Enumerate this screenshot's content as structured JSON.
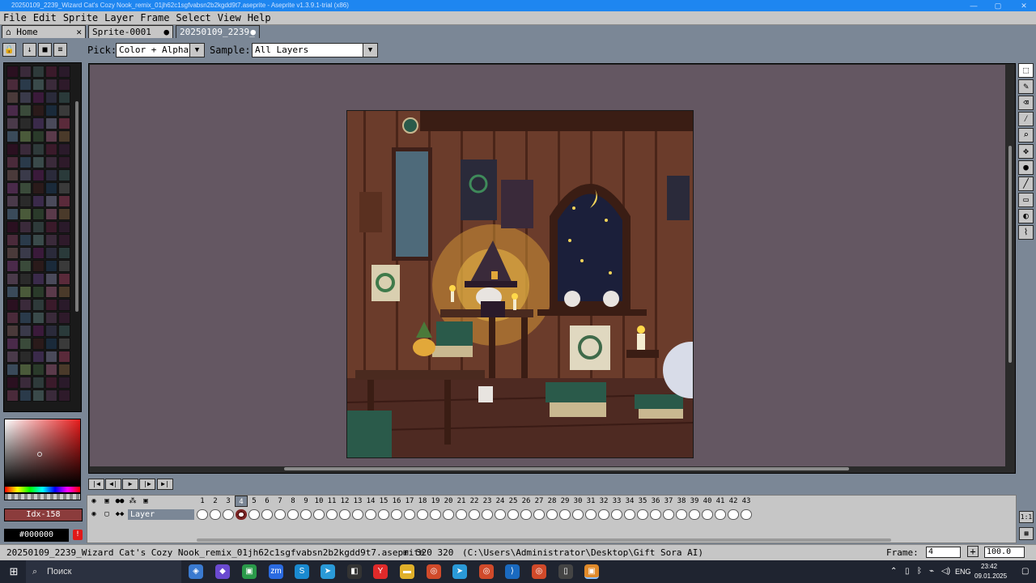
{
  "window": {
    "title": "20250109_2239_Wizard Cat's Cozy Nook_remix_01jh62c1sgfvabsn2b2kgdd9t7.aseprite - Aseprite v1.3.9.1-trial (x86)",
    "min_label": "—",
    "max_label": "▢",
    "close_label": "✕"
  },
  "menu": [
    "File",
    "Edit",
    "Sprite",
    "Layer",
    "Frame",
    "Select",
    "View",
    "Help"
  ],
  "tabs": [
    {
      "label": "Home",
      "close": "✕",
      "icon": "home-icon"
    },
    {
      "label": "Sprite-0001",
      "close": "●"
    },
    {
      "label": "20250109_2239_",
      "close": "●"
    }
  ],
  "tool_options": {
    "pick_label": "Pick:",
    "pick_value": "Color + Alpha",
    "sample_label": "Sample:",
    "sample_value": "All Layers"
  },
  "palette": {
    "colors": [
      "#2a1020",
      "#3a2a3a",
      "#2e3a3a",
      "#3a1a2a",
      "#2a1a2a",
      "#4a2a3a",
      "#2a3a4a",
      "#3a4a4a",
      "#3a2a3a",
      "#2e1a2a",
      "#4a3a3a",
      "#3a3a4a",
      "#3a1a3a",
      "#2a2a3a",
      "#2a3a3a",
      "#4a2a4a",
      "#3a4a3a",
      "#2a1a1a",
      "#1a2a3a",
      "#3a3a3a",
      "#4a3a4a",
      "#2a2a2a",
      "#3a2a4a",
      "#4a4a5a",
      "#5a2a3a",
      "#3a4a5a",
      "#4a5a3a",
      "#2a3a2a",
      "#5a3a4a",
      "#4a3a2a"
    ],
    "index_label": "Idx-158",
    "hex_label": "#000000",
    "warn_icon": "!"
  },
  "timeline": {
    "frames": [
      1,
      2,
      3,
      4,
      5,
      6,
      7,
      8,
      9,
      10,
      11,
      12,
      13,
      14,
      15,
      16,
      17,
      18,
      19,
      20,
      21,
      22,
      23,
      24,
      25,
      26,
      27,
      28,
      29,
      30,
      31,
      32,
      33,
      34,
      35,
      36,
      37,
      38,
      39,
      40,
      41,
      42,
      43
    ],
    "current_frame": 4,
    "layer_name": "Layer"
  },
  "status": {
    "filename": "20250109_2239_Wizard Cat's Cozy Nook_remix_01jh62c1sgfvabsn2b2kgdd9t7.aseprite",
    "size": "320 320",
    "path": "(C:\\Users\\Administrator\\Desktop\\Gift Sora AI)",
    "frame_label": "Frame:",
    "frame_value": "4",
    "plus": "+",
    "zoom_value": "100.0"
  },
  "taskbar": {
    "search_placeholder": "Поиск",
    "time": "23:42",
    "date": "09.01.2025",
    "lang": "ENG"
  },
  "colors": {
    "accent": "#1e86f0",
    "bg": "#7b8796",
    "panel": "#c6c6c6",
    "canvas": "#645762"
  }
}
